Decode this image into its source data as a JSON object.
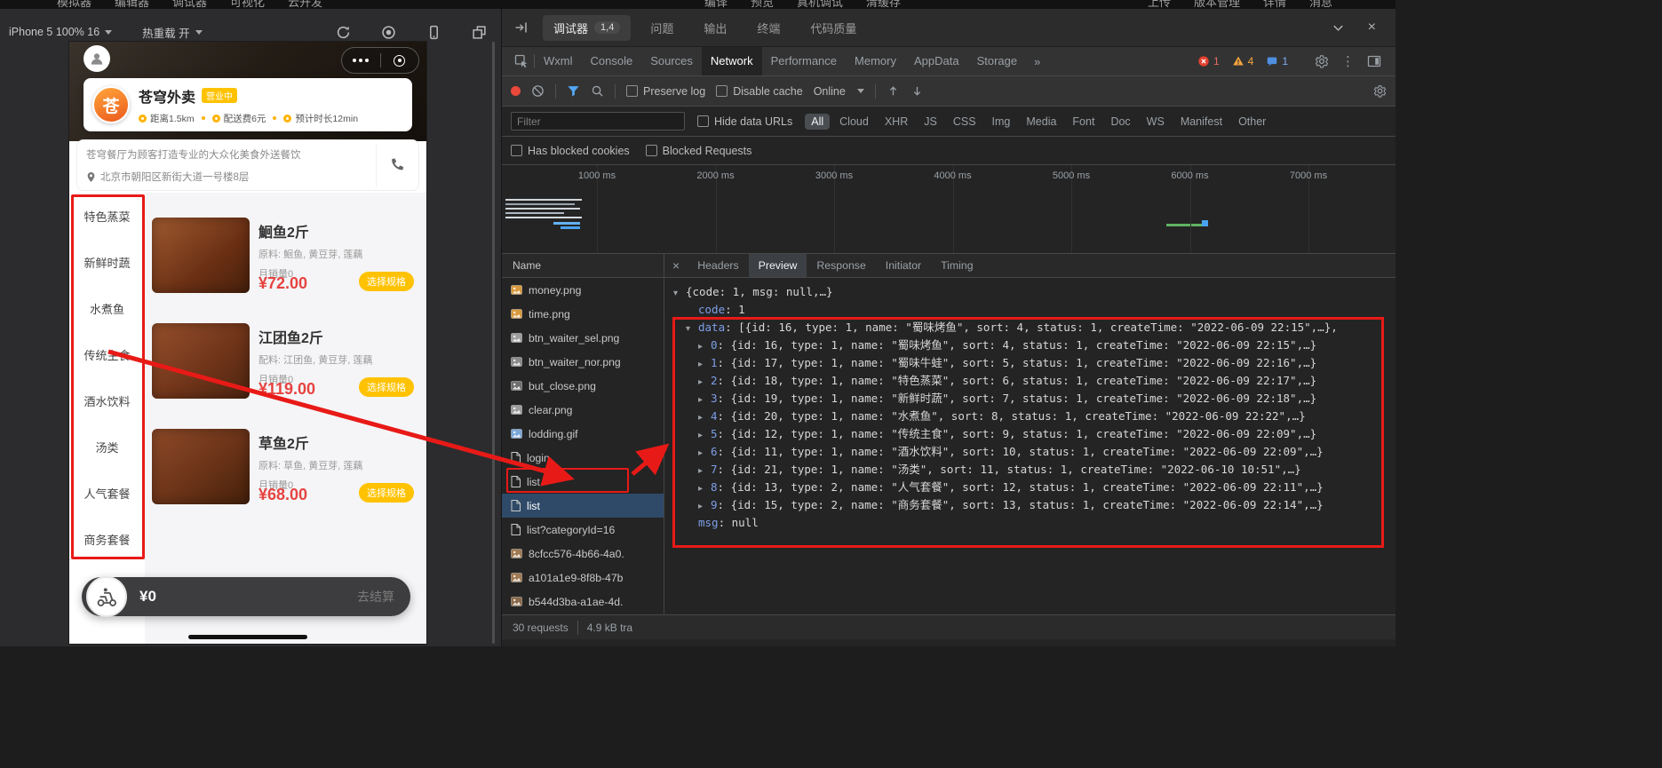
{
  "colors": {
    "annotation_red": "#e81a17",
    "brand_yellow": "#ffc200",
    "price_red": "#e64340",
    "json_key_blue": "#7d9fe8",
    "selected_row_blue": "#2f4a68"
  },
  "menubar": {
    "left": [
      "模拟器",
      "编辑器",
      "调试器",
      "可视化",
      "云开发"
    ],
    "middle": [
      "编译",
      "预览",
      "真机调试",
      "清缓存"
    ],
    "right": [
      "上传",
      "版本管理",
      "详情",
      "消息"
    ]
  },
  "simulator": {
    "device_selector": "iPhone 5 100% 16",
    "hot_reload": "热重载 开",
    "store": {
      "logo_char": "苍",
      "name": "苍穹外卖",
      "badge": "营业中",
      "meta": [
        "距离1.5km",
        "配送费6元",
        "预计时长12min"
      ],
      "description": "苍穹餐厅为顾客打造专业的大众化美食外送餐饮",
      "address": "北京市朝阳区新街大道一号楼8层"
    },
    "categories": [
      "特色蒸菜",
      "新鲜时蔬",
      "水煮鱼",
      "传统主食",
      "酒水饮料",
      "汤类",
      "人气套餐",
      "商务套餐"
    ],
    "dishes": [
      {
        "name": "鮰鱼2斤",
        "ingredients": "原料: 鮰鱼, 黄豆芽, 莲藕",
        "sales": "月销量0",
        "price": "¥72.00",
        "action": "选择规格"
      },
      {
        "name": "江团鱼2斤",
        "ingredients": "配料: 江团鱼, 黄豆芽, 莲藕",
        "sales": "月销量0",
        "price": "¥119.00",
        "action": "选择规格"
      },
      {
        "name": "草鱼2斤",
        "ingredients": "原料: 草鱼, 黄豆芽, 莲藕",
        "sales": "月销量0",
        "price": "¥68.00",
        "action": "选择规格"
      }
    ],
    "cart": {
      "total": "¥0",
      "checkout": "去结算"
    }
  },
  "devtools": {
    "panel_tabs": [
      {
        "label": "调试器",
        "badge": "1,4",
        "active": true
      },
      {
        "label": "问题",
        "badge": "",
        "active": false
      },
      {
        "label": "输出",
        "badge": "",
        "active": false
      },
      {
        "label": "终端",
        "badge": "",
        "active": false
      },
      {
        "label": "代码质量",
        "badge": "",
        "active": false
      }
    ],
    "inspector_tabs": [
      "Wxml",
      "Console",
      "Sources",
      "Network",
      "Performance",
      "Memory",
      "AppData",
      "Storage"
    ],
    "active_inspector_tab": "Network",
    "overflow_chevron": "»",
    "status_counts": {
      "errors": "1",
      "warnings": "4",
      "infos": "1"
    },
    "network_controls": {
      "preserve_log": "Preserve log",
      "disable_cache": "Disable cache",
      "throttling": "Online"
    },
    "filter_bar": {
      "placeholder": "Filter",
      "hide_data_urls": "Hide data URLs",
      "types": [
        "All",
        "Cloud",
        "XHR",
        "JS",
        "CSS",
        "Img",
        "Media",
        "Font",
        "Doc",
        "WS",
        "Manifest",
        "Other"
      ],
      "active_type": "All"
    },
    "blocked_row": [
      "Has blocked cookies",
      "Blocked Requests"
    ],
    "timeline_labels": [
      "1000 ms",
      "2000 ms",
      "3000 ms",
      "4000 ms",
      "5000 ms",
      "6000 ms",
      "7000 ms"
    ],
    "requests_header": "Name",
    "requests": [
      {
        "name": "money.png",
        "icon": "image",
        "tint": "#d99a3d"
      },
      {
        "name": "time.png",
        "icon": "image",
        "tint": "#d99a3d"
      },
      {
        "name": "btn_waiter_sel.png",
        "icon": "image",
        "tint": "#9e9e9e"
      },
      {
        "name": "btn_waiter_nor.png",
        "icon": "image",
        "tint": "#8a8a8a"
      },
      {
        "name": "but_close.png",
        "icon": "image",
        "tint": "#6f6f6f"
      },
      {
        "name": "clear.png",
        "icon": "image",
        "tint": "#9e9e9e"
      },
      {
        "name": "lodding.gif",
        "icon": "image",
        "tint": "#7da7d9"
      },
      {
        "name": "login",
        "icon": "doc"
      },
      {
        "name": "list",
        "icon": "doc",
        "boxed": true
      },
      {
        "name": "list",
        "icon": "doc",
        "selected": true
      },
      {
        "name": "list?categoryId=16",
        "icon": "doc"
      },
      {
        "name": "8cfcc576-4b66-4a0.",
        "icon": "image",
        "tint": "#a07a52"
      },
      {
        "name": "a101a1e9-8f8b-47b",
        "icon": "image",
        "tint": "#a07a52"
      },
      {
        "name": "b544d3ba-a1ae-4d.",
        "icon": "image",
        "tint": "#8a6a4a"
      }
    ],
    "summary": {
      "count": "30 requests",
      "transferred": "4.9 kB tra"
    },
    "detail_tabs": [
      "Headers",
      "Preview",
      "Response",
      "Initiator",
      "Timing"
    ],
    "active_detail_tab": "Preview",
    "preview": {
      "lines": [
        {
          "indent": 0,
          "arrow": "▾",
          "key": "",
          "rest": "{code: 1, msg: null,…}"
        },
        {
          "indent": 1,
          "arrow": "",
          "key": "code",
          "rest": ": 1"
        },
        {
          "indent": 1,
          "arrow": "▾",
          "key": "data",
          "rest": ": [{id: 16, type: 1, name: \"蜀味烤鱼\", sort: 4, status: 1, createTime: \"2022-06-09 22:15\",…},"
        },
        {
          "indent": 2,
          "arrow": "▸",
          "key": "0",
          "rest": ": {id: 16, type: 1, name: \"蜀味烤鱼\", sort: 4, status: 1, createTime: \"2022-06-09 22:15\",…}"
        },
        {
          "indent": 2,
          "arrow": "▸",
          "key": "1",
          "rest": ": {id: 17, type: 1, name: \"蜀味牛蛙\", sort: 5, status: 1, createTime: \"2022-06-09 22:16\",…}"
        },
        {
          "indent": 2,
          "arrow": "▸",
          "key": "2",
          "rest": ": {id: 18, type: 1, name: \"特色蒸菜\", sort: 6, status: 1, createTime: \"2022-06-09 22:17\",…}"
        },
        {
          "indent": 2,
          "arrow": "▸",
          "key": "3",
          "rest": ": {id: 19, type: 1, name: \"新鲜时蔬\", sort: 7, status: 1, createTime: \"2022-06-09 22:18\",…}"
        },
        {
          "indent": 2,
          "arrow": "▸",
          "key": "4",
          "rest": ": {id: 20, type: 1, name: \"水煮鱼\", sort: 8, status: 1, createTime: \"2022-06-09 22:22\",…}"
        },
        {
          "indent": 2,
          "arrow": "▸",
          "key": "5",
          "rest": ": {id: 12, type: 1, name: \"传统主食\", sort: 9, status: 1, createTime: \"2022-06-09 22:09\",…}"
        },
        {
          "indent": 2,
          "arrow": "▸",
          "key": "6",
          "rest": ": {id: 11, type: 1, name: \"酒水饮料\", sort: 10, status: 1, createTime: \"2022-06-09 22:09\",…}"
        },
        {
          "indent": 2,
          "arrow": "▸",
          "key": "7",
          "rest": ": {id: 21, type: 1, name: \"汤类\", sort: 11, status: 1, createTime: \"2022-06-10 10:51\",…}"
        },
        {
          "indent": 2,
          "arrow": "▸",
          "key": "8",
          "rest": ": {id: 13, type: 2, name: \"人气套餐\", sort: 12, status: 1, createTime: \"2022-06-09 22:11\",…}"
        },
        {
          "indent": 2,
          "arrow": "▸",
          "key": "9",
          "rest": ": {id: 15, type: 2, name: \"商务套餐\", sort: 13, status: 1, createTime: \"2022-06-09 22:14\",…}"
        },
        {
          "indent": 1,
          "arrow": "",
          "key": "msg",
          "rest": ": null"
        }
      ]
    }
  }
}
